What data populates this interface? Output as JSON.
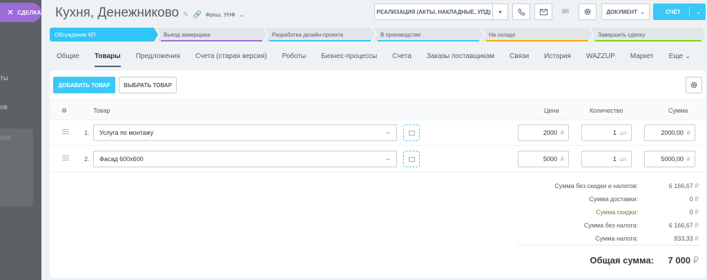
{
  "deal_tab": {
    "label": "СДЕЛКА"
  },
  "left_fragments": [
    "ты",
    "ов",
    "ота"
  ],
  "header": {
    "title": "Кухня, Денежниково",
    "link": "Фреш. УНФ"
  },
  "buttons": {
    "realization": "РЕАЛИЗАЦИЯ (АКТЫ, НАКЛАДНЫЕ, УПД)",
    "document": "ДОКУМЕНТ",
    "bill": "СЧЁТ"
  },
  "stages": [
    {
      "label": "Обсуждение КП",
      "color": "#2fc6f6"
    },
    {
      "label": "Выезд замерщика",
      "color": "#9b6bd6"
    },
    {
      "label": "Разработка дизайн-проекта",
      "color": "#2fc6f6"
    },
    {
      "label": "В производстве",
      "color": "#3bc8f5"
    },
    {
      "label": "На складе",
      "color": "#f7a700"
    },
    {
      "label": "Завершить сделку",
      "color": "#7bd500"
    }
  ],
  "tabs": [
    "Общие",
    "Товары",
    "Предложения",
    "Счета (старая версия)",
    "Роботы",
    "Бизнес-процессы",
    "Счета",
    "Заказы поставщикам",
    "Связи",
    "История",
    "WAZZUP",
    "Маркет",
    "Еще"
  ],
  "products_toolbar": {
    "add": "ДОБАВИТЬ ТОВАР",
    "choose": "ВЫБРАТЬ ТОВАР"
  },
  "table": {
    "columns": {
      "product": "Товар",
      "price": "Цена",
      "quantity": "Количество",
      "sum": "Сумма"
    },
    "rows": [
      {
        "num": "1.",
        "name": "Услуга по монтажу",
        "price": "2000",
        "qty": "1",
        "unit": "шт",
        "sum": "2000,00"
      },
      {
        "num": "2.",
        "name": "Фасад 600х600",
        "price": "5000",
        "qty": "1",
        "unit": "шт",
        "sum": "5000,00"
      }
    ],
    "currency": "₽"
  },
  "totals": {
    "without_discount_label": "Сумма без скидки и налогов:",
    "without_discount": "6 166,67",
    "delivery_label": "Сумма доставки:",
    "delivery": "0",
    "discount_label": "Сумма скидки:",
    "discount": "0",
    "without_tax_label": "Сумма без налога:",
    "without_tax": "6 166,67",
    "tax_label": "Сумма налога:",
    "tax": "833,33",
    "total_label": "Общая сумма:",
    "total": "7 000"
  }
}
